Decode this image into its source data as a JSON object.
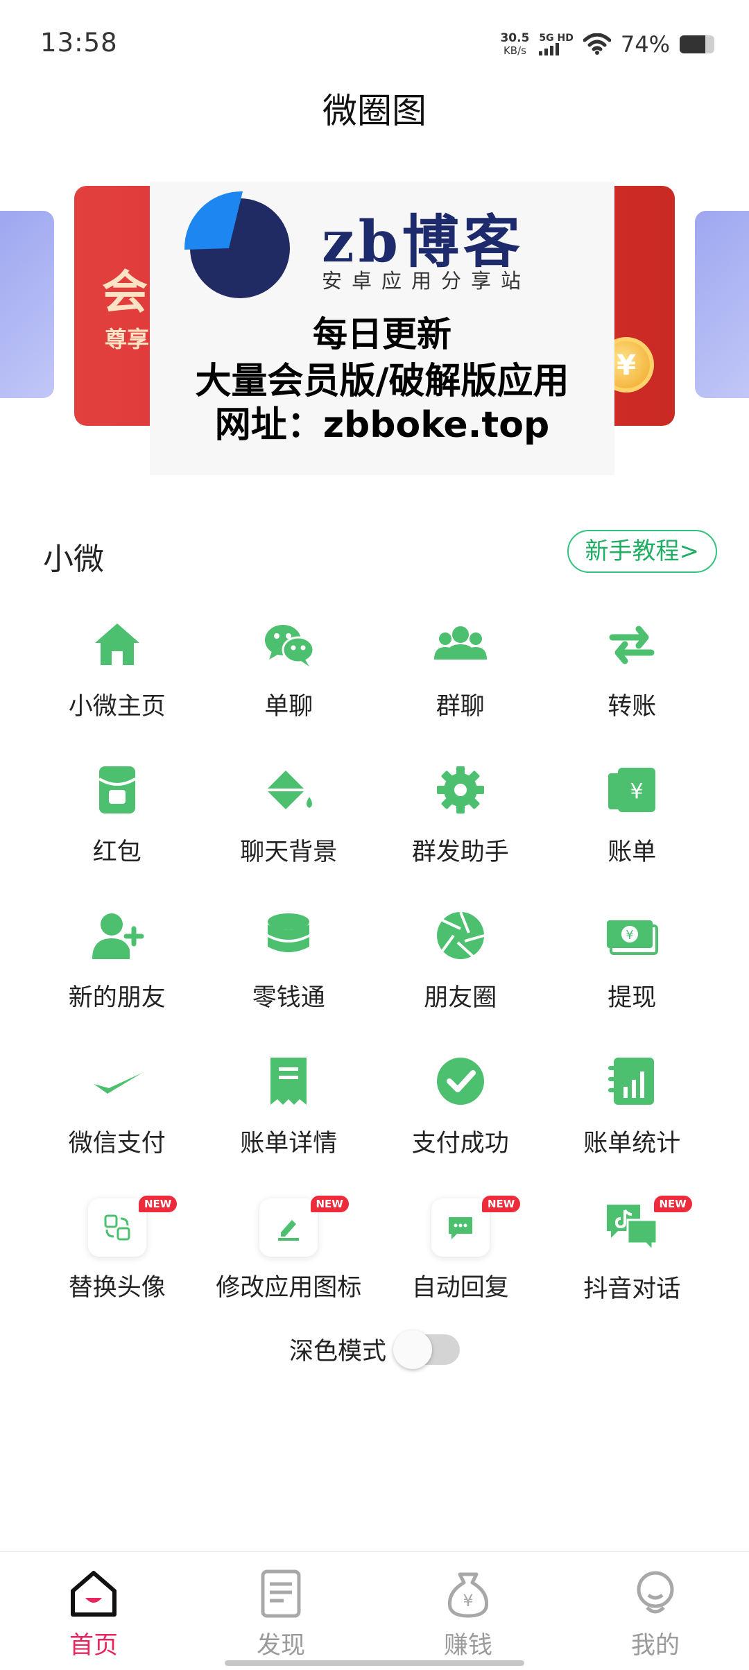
{
  "status_bar": {
    "time": "13:58",
    "net_speed": "30.5",
    "net_unit": "KB/s",
    "signal_label": "5G HD",
    "battery": "74%",
    "battery_level": 0.74
  },
  "header": {
    "title": "微圈图"
  },
  "banner": {
    "promo_big": "会",
    "promo_sub": "尊享",
    "coin_symbol": "¥",
    "ad_logo_text": "zb博客",
    "ad_logo_sub": "安卓应用分享站",
    "ad_line1": "每日更新",
    "ad_line2": "大量会员版/破解版应用",
    "ad_line3": "网址：zbboke.top"
  },
  "section": {
    "title": "小微",
    "tutorial_button": "新手教程>"
  },
  "grid": [
    {
      "label": "小微主页",
      "icon": "home-icon"
    },
    {
      "label": "单聊",
      "icon": "wechat-icon"
    },
    {
      "label": "群聊",
      "icon": "group-icon"
    },
    {
      "label": "转账",
      "icon": "transfer-icon"
    },
    {
      "label": "红包",
      "icon": "red-packet-icon"
    },
    {
      "label": "聊天背景",
      "icon": "paint-bucket-icon"
    },
    {
      "label": "群发助手",
      "icon": "gear-icon"
    },
    {
      "label": "账单",
      "icon": "bill-icon"
    },
    {
      "label": "新的朋友",
      "icon": "add-friend-icon"
    },
    {
      "label": "零钱通",
      "icon": "coins-stack-icon"
    },
    {
      "label": "朋友圈",
      "icon": "aperture-icon"
    },
    {
      "label": "提现",
      "icon": "cash-icon"
    },
    {
      "label": "微信支付",
      "icon": "checkmark-icon"
    },
    {
      "label": "账单详情",
      "icon": "receipt-icon"
    },
    {
      "label": "支付成功",
      "icon": "check-circle-icon"
    },
    {
      "label": "账单统计",
      "icon": "stats-icon"
    },
    {
      "label": "替换头像",
      "icon": "swap-avatar-icon",
      "badge": "NEW"
    },
    {
      "label": "修改应用图标",
      "icon": "edit-icon",
      "badge": "NEW"
    },
    {
      "label": "自动回复",
      "icon": "message-icon",
      "badge": "NEW"
    },
    {
      "label": "抖音对话",
      "icon": "tiktok-chat-icon",
      "badge": "NEW"
    }
  ],
  "dark_mode": {
    "label": "深色模式",
    "enabled": false
  },
  "bottom_nav": [
    {
      "label": "首页",
      "active": true
    },
    {
      "label": "发现",
      "active": false
    },
    {
      "label": "赚钱",
      "active": false
    },
    {
      "label": "我的",
      "active": false
    }
  ],
  "colors": {
    "accent_green": "#31c27c",
    "active_nav": "#e8265e",
    "badge_red": "#ee2b3b"
  }
}
